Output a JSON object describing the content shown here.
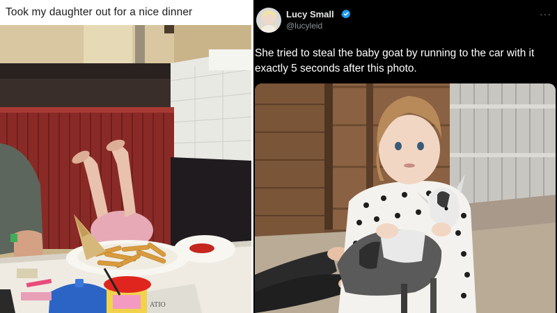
{
  "left_post": {
    "caption": "Took my daughter out for a nice dinner",
    "photo_alt": "Child in restaurant booth with legs up, plate of fries on table"
  },
  "tweet": {
    "display_name": "Lucy Small",
    "handle": "@lucyleid",
    "verified": true,
    "text": "She tried to steal the baby goat by running to the car with it exactly 5 seconds after this photo.",
    "more_icon": "ellipsis-icon",
    "photo_alt": "Toddler in polka-dot sweater holding a baby goat in a barn"
  },
  "colors": {
    "tweet_bg": "#000000",
    "verified_blue": "#1d9bf0",
    "handle_gray": "#8b949b",
    "booth_red": "#8a2a26"
  }
}
